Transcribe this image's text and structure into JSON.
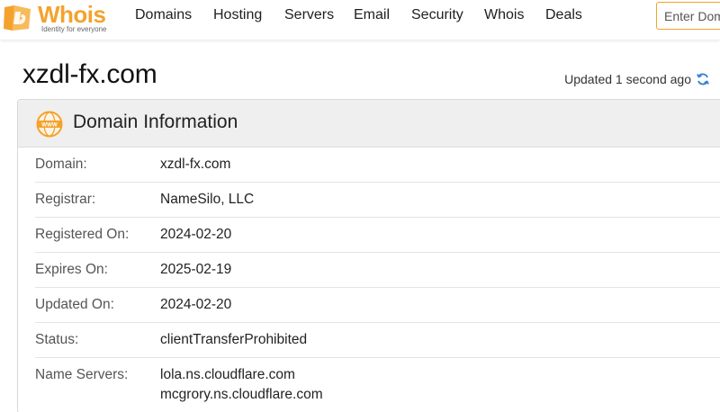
{
  "header": {
    "logo_text": "Whois",
    "logo_tagline": "Identity for everyone",
    "nav": [
      "Domains",
      "Hosting",
      "Servers",
      "Email",
      "Security",
      "Whois",
      "Deals"
    ],
    "search_placeholder": "Enter Domain"
  },
  "page": {
    "title": "xzdl-fx.com",
    "updated": "Updated 1 second ago"
  },
  "panel": {
    "title": "Domain Information",
    "rows": [
      {
        "label": "Domain:",
        "value": "xzdl-fx.com"
      },
      {
        "label": "Registrar:",
        "value": "NameSilo, LLC"
      },
      {
        "label": "Registered On:",
        "value": "2024-02-20"
      },
      {
        "label": "Expires On:",
        "value": "2025-02-19"
      },
      {
        "label": "Updated On:",
        "value": "2024-02-20"
      },
      {
        "label": "Status:",
        "value": "clientTransferProhibited"
      },
      {
        "label": "Name Servers:",
        "values": [
          "lola.ns.cloudflare.com",
          "mcgrory.ns.cloudflare.com"
        ]
      }
    ]
  },
  "colors": {
    "brand_orange": "#f4a22d",
    "refresh_blue": "#2f7fd6"
  },
  "icons": {
    "logo": "whois-logo-icon",
    "refresh": "refresh-icon",
    "panel": "www-globe-icon"
  }
}
